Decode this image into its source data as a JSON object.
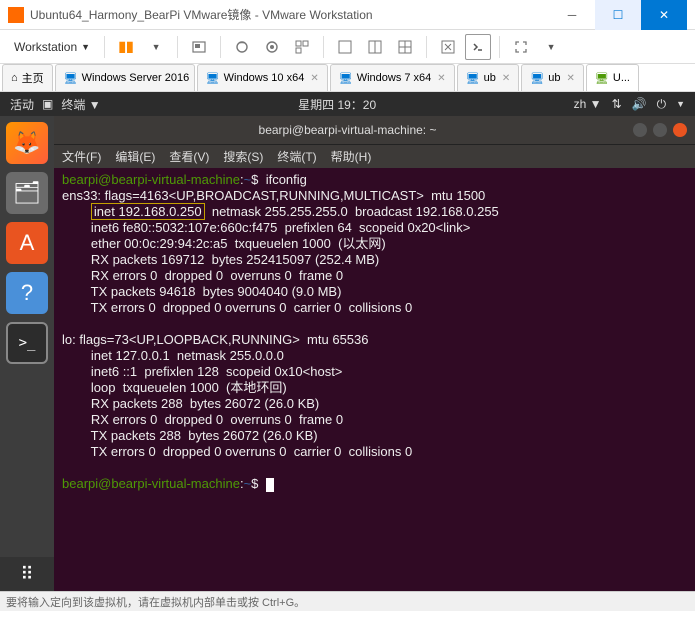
{
  "window": {
    "title": "Ubuntu64_Harmony_BearPi VMware镜像 - VMware Workstation"
  },
  "menu": {
    "workstation": "Workstation"
  },
  "tabs": {
    "home": "主页",
    "t1": "Windows Server 2016",
    "t2": "Windows 10 x64",
    "t3": "Windows 7 x64",
    "t4": "ub",
    "t5": "ub",
    "t6": "U..."
  },
  "ubuntu": {
    "topbar": {
      "activity": "活动",
      "app": "终端",
      "clock": "星期四 19：20",
      "lang": "zh"
    },
    "term": {
      "title": "bearpi@bearpi-virtual-machine: ~",
      "menu": {
        "file": "文件(F)",
        "edit": "编辑(E)",
        "view": "查看(V)",
        "search": "搜索(S)",
        "terminal": "终端(T)",
        "help": "帮助(H)"
      },
      "prompt_user": "bearpi@bearpi-virtual-machine",
      "prompt_sep": ":",
      "prompt_path": "~",
      "prompt_end": "$",
      "cmd": "ifconfig",
      "highlight": "inet 192.168.0.250",
      "lines": {
        "l1": "ens33: flags=4163<UP,BROADCAST,RUNNING,MULTICAST>  mtu 1500",
        "l2a": "        ",
        "l2b": "  netmask 255.255.255.0  broadcast 192.168.0.255",
        "l3": "        inet6 fe80::5032:107e:660c:f475  prefixlen 64  scopeid 0x20<link>",
        "l4": "        ether 00:0c:29:94:2c:a5  txqueuelen 1000  (以太网)",
        "l5": "        RX packets 169712  bytes 252415097 (252.4 MB)",
        "l6": "        RX errors 0  dropped 0  overruns 0  frame 0",
        "l7": "        TX packets 94618  bytes 9004040 (9.0 MB)",
        "l8": "        TX errors 0  dropped 0 overruns 0  carrier 0  collisions 0",
        "l9": "",
        "l10": "lo: flags=73<UP,LOOPBACK,RUNNING>  mtu 65536",
        "l11": "        inet 127.0.0.1  netmask 255.0.0.0",
        "l12": "        inet6 ::1  prefixlen 128  scopeid 0x10<host>",
        "l13": "        loop  txqueuelen 1000  (本地环回)",
        "l14": "        RX packets 288  bytes 26072 (26.0 KB)",
        "l15": "        RX errors 0  dropped 0  overruns 0  frame 0",
        "l16": "        TX packets 288  bytes 26072 (26.0 KB)",
        "l17": "        TX errors 0  dropped 0 overruns 0  carrier 0  collisions 0",
        "l18": ""
      }
    }
  },
  "status": {
    "text": "要将输入定向到该虚拟机，请在虚拟机内部单击或按 Ctrl+G。"
  }
}
